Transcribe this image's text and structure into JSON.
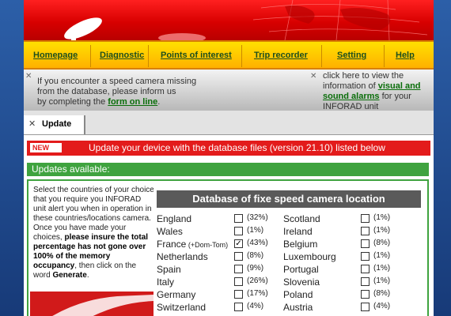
{
  "nav": {
    "items": [
      "Homepage",
      "Diagnostic",
      "Points of interest",
      "Trip recorder",
      "Setting",
      "Help"
    ]
  },
  "info": {
    "left_text1": "If you encounter a speed camera missing",
    "left_text2": "from the database, please inform us",
    "left_text3": "by completing the",
    "left_link": "form on line",
    "left_text4": ".",
    "right_text1": "click here to view the",
    "right_text2": "information of",
    "right_link1": "visual and",
    "right_link2": "sound alarms",
    "right_text3": "for your",
    "right_text4": "INFORAD unit"
  },
  "tab": {
    "close": "✕",
    "label": "Update"
  },
  "banner_update": {
    "badge": "NEW",
    "message": "Update your device with the database files (version 21.10) listed below"
  },
  "updates": {
    "heading": "Updates available:"
  },
  "help": {
    "part1": "Select the countries of your choice that you require you INFORAD unit alert you when in operation in these countries/locations camera. Once you have made your choices,",
    "bold1": "please insure the total percentage has not gone over 100% of the memory occupancy",
    "part2": ", then click on the word",
    "bold2": "Generate",
    "part3": "."
  },
  "database": {
    "title": "Database of fixe speed camera location",
    "left": [
      {
        "name": "England",
        "sub": "",
        "checked": false,
        "pct": "(32%)"
      },
      {
        "name": "Wales",
        "sub": "",
        "checked": false,
        "pct": "(1%)"
      },
      {
        "name": "France",
        "sub": "(+Dom-Tom)",
        "checked": true,
        "pct": "(43%)"
      },
      {
        "name": "Netherlands",
        "sub": "",
        "checked": false,
        "pct": "(8%)"
      },
      {
        "name": "Spain",
        "sub": "",
        "checked": false,
        "pct": "(9%)"
      },
      {
        "name": "Italy",
        "sub": "",
        "checked": false,
        "pct": "(26%)"
      },
      {
        "name": "Germany",
        "sub": "",
        "checked": false,
        "pct": "(17%)"
      },
      {
        "name": "Switzerland",
        "sub": "",
        "checked": false,
        "pct": "(4%)"
      }
    ],
    "right": [
      {
        "name": "Scotland",
        "checked": false,
        "pct": "(1%)"
      },
      {
        "name": "Ireland",
        "checked": false,
        "pct": "(1%)"
      },
      {
        "name": "Belgium",
        "checked": false,
        "pct": "(8%)"
      },
      {
        "name": "Luxembourg",
        "checked": false,
        "pct": "(1%)"
      },
      {
        "name": "Portugal",
        "checked": false,
        "pct": "(1%)"
      },
      {
        "name": "Slovenia",
        "checked": false,
        "pct": "(1%)"
      },
      {
        "name": "Poland",
        "checked": false,
        "pct": "(8%)"
      },
      {
        "name": "Austria",
        "checked": false,
        "pct": "(4%)"
      }
    ]
  },
  "colors": {
    "banner_red": "#d80000",
    "nav_yellow": "#ffc400",
    "link_green": "#0a6e0a",
    "update_red": "#e31b1b",
    "update_green": "#3fa33f"
  },
  "icons": {
    "close": "x-icon",
    "check": "check-icon"
  }
}
